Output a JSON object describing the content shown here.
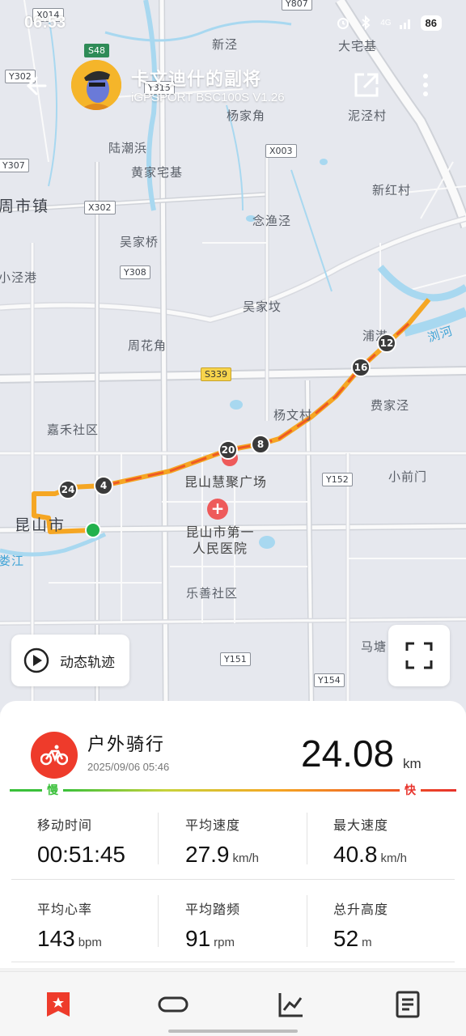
{
  "status_bar": {
    "time": "06:53",
    "network": "4G",
    "battery": "86"
  },
  "header": {
    "user_name": "卡文迪什的副将",
    "device": "iGPSPORT BSC100S  V1.26"
  },
  "map": {
    "place_labels": [
      {
        "text": "新泾"
      },
      {
        "text": "大宅基"
      },
      {
        "text": "杨家角"
      },
      {
        "text": "泥泾村"
      },
      {
        "text": "陆潮浜"
      },
      {
        "text": "黄家宅基"
      },
      {
        "text": "新红村"
      },
      {
        "text": "周市镇"
      },
      {
        "text": "念渔泾"
      },
      {
        "text": "吴家桥"
      },
      {
        "text": "小泾港"
      },
      {
        "text": "吴家坟"
      },
      {
        "text": "周花角"
      },
      {
        "text": "浦港"
      },
      {
        "text": "浏河"
      },
      {
        "text": "费家泾"
      },
      {
        "text": "杨文村"
      },
      {
        "text": "嘉禾社区"
      },
      {
        "text": "小前门"
      },
      {
        "text": "昆山市"
      },
      {
        "text": "娄江"
      },
      {
        "text": "乐善社区"
      },
      {
        "text": "马塘"
      },
      {
        "text": "昆山慧聚广场"
      },
      {
        "text": "昆山市第一人民医院"
      }
    ],
    "road_codes": [
      "X014",
      "Y807",
      "S48",
      "Y302",
      "Y315",
      "X003",
      "Y307",
      "X302",
      "Y308",
      "S339",
      "Y152",
      "Y151",
      "Y154"
    ],
    "km_markers": [
      "24",
      "4",
      "20",
      "8",
      "16",
      "12"
    ],
    "track_button_label": "动态轨迹"
  },
  "activity": {
    "type": "户外骑行",
    "date": "2025/09/06 05:46",
    "distance": "24.08",
    "distance_unit": "km",
    "legend_slow": "慢",
    "legend_fast": "快",
    "stats": [
      {
        "label": "移动时间",
        "value": "00:51:45",
        "unit": ""
      },
      {
        "label": "平均速度",
        "value": "27.9",
        "unit": "km/h"
      },
      {
        "label": "最大速度",
        "value": "40.8",
        "unit": "km/h"
      },
      {
        "label": "平均心率",
        "value": "143",
        "unit": "bpm"
      },
      {
        "label": "平均踏频",
        "value": "91",
        "unit": "rpm"
      },
      {
        "label": "总升高度",
        "value": "52",
        "unit": "m"
      }
    ]
  },
  "bottom_nav": {
    "items": [
      {
        "icon": "bookmark-star-icon",
        "active": true
      },
      {
        "icon": "loop-track-icon",
        "active": false
      },
      {
        "icon": "chart-line-icon",
        "active": false
      },
      {
        "icon": "document-list-icon",
        "active": false
      }
    ]
  },
  "colors": {
    "accent": "#ee3b2b",
    "track_orange": "#f5a623",
    "track_red": "#e8322b",
    "map_bg": "#e6e8ee",
    "water": "#a8d8f0"
  }
}
